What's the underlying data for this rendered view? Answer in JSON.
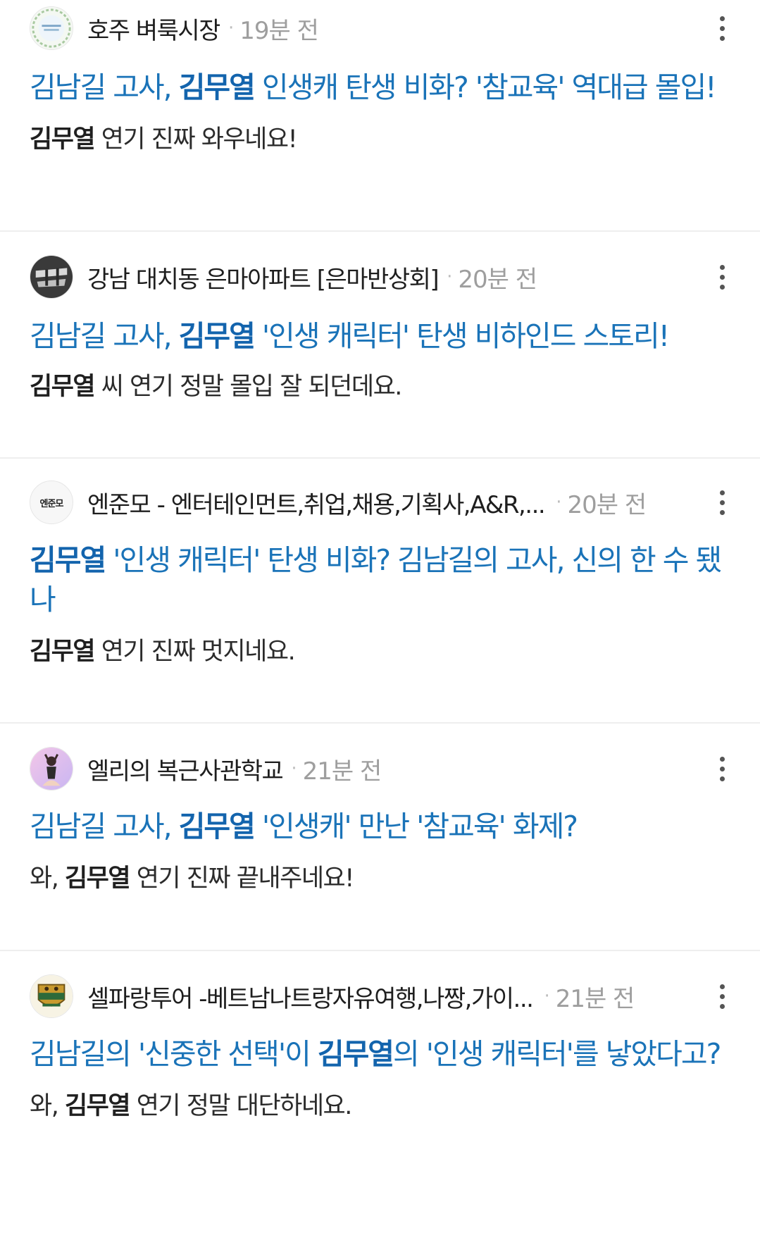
{
  "posts": [
    {
      "cafe": "호주 벼룩시장",
      "time": "19분 전",
      "title_pre": "김남길 고사, ",
      "title_bold": "김무열",
      "title_post": " 인생캐 탄생 비화? '참교육' 역대급 몰입!",
      "snippet_pre": "",
      "snippet_bold": "김무열",
      "snippet_post": " 연기 진짜 와우네요!",
      "avatar_icon": "cafe-logo-icon"
    },
    {
      "cafe": "강남 대치동 은마아파트 [은마반상회]",
      "time": "20분 전",
      "title_pre": "김남길 고사, ",
      "title_bold": "김무열",
      "title_post": " '인생 캐릭터' 탄생 비하인드 스토리!",
      "snippet_pre": "",
      "snippet_bold": "김무열",
      "snippet_post": " 씨 연기 정말 몰입 잘 되던데요.",
      "avatar_icon": "cafe-logo-icon"
    },
    {
      "cafe": "엔준모 - 엔터테인먼트,취업,채용,기획사,A&R,...",
      "time": "20분 전",
      "title_pre": "",
      "title_bold": "김무열",
      "title_post": " '인생 캐릭터' 탄생 비화? 김남길의 고사, 신의 한 수 됐나",
      "snippet_pre": "",
      "snippet_bold": "김무열",
      "snippet_post": " 연기 진짜 멋지네요.",
      "avatar_icon": "cafe-logo-icon",
      "avatar_text": "엔준모"
    },
    {
      "cafe": "엘리의 복근사관학교",
      "time": "21분 전",
      "title_pre": "김남길 고사, ",
      "title_bold": "김무열",
      "title_post": " '인생캐' 만난 '참교육' 화제?",
      "snippet_pre": "와, ",
      "snippet_bold": "김무열",
      "snippet_post": " 연기 진짜 끝내주네요!",
      "avatar_icon": "cafe-logo-icon"
    },
    {
      "cafe": "셀파랑투어 -베트남나트랑자유여행,나짱,가이...",
      "time": "21분 전",
      "title_pre": "김남길의 '신중한 선택'이 ",
      "title_bold": "김무열",
      "title_post": "의 '인생 캐릭터'를 낳았다고?",
      "snippet_pre": "와, ",
      "snippet_bold": "김무열",
      "snippet_post": " 연기 정말 대단하네요.",
      "avatar_icon": "cafe-logo-icon"
    }
  ],
  "ui": {
    "dot": "·",
    "more_icon": "more-vertical-icon"
  },
  "colors": {
    "title": "#1a73b8",
    "title_bold": "#1364ad",
    "meta": "#9e9e9e",
    "divider": "#eeeeee"
  }
}
